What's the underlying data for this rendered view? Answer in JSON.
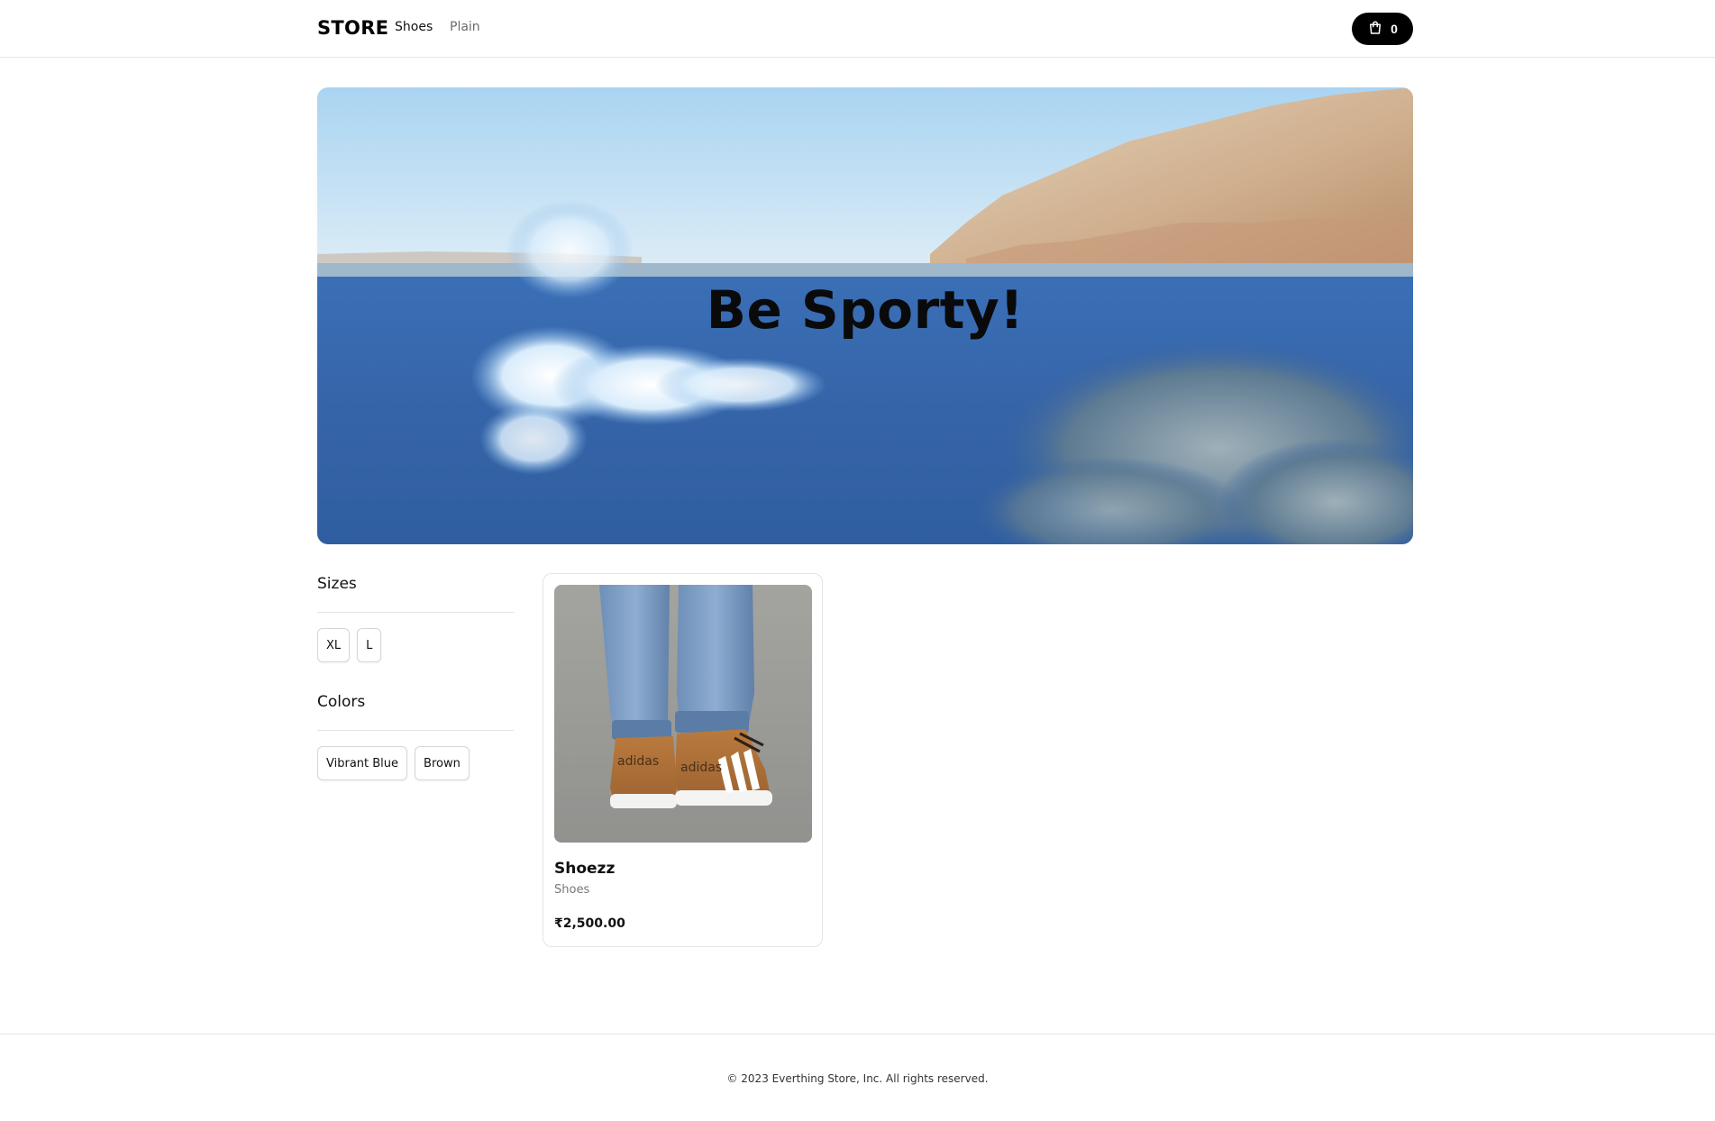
{
  "header": {
    "brand": "STORE",
    "nav": [
      {
        "label": "Shoes"
      },
      {
        "label": "Plain"
      }
    ],
    "cart": {
      "count": "0",
      "icon": "shopping-bag-icon"
    }
  },
  "hero": {
    "title": "Be Sporty!"
  },
  "filters": {
    "sizes": {
      "heading": "Sizes",
      "options": [
        "XL",
        "L"
      ]
    },
    "colors": {
      "heading": "Colors",
      "options": [
        "Vibrant Blue",
        "Brown"
      ]
    }
  },
  "products": [
    {
      "name": "Shoezz",
      "category": "Shoes",
      "price": "₹2,500.00",
      "image_brand_text": "adidas"
    }
  ],
  "footer": {
    "text": "© 2023 Everthing Store, Inc. All rights reserved."
  },
  "colors": {
    "background": "#ffffff",
    "text": "#111111",
    "muted": "#777777",
    "cart_button": "#000000"
  }
}
